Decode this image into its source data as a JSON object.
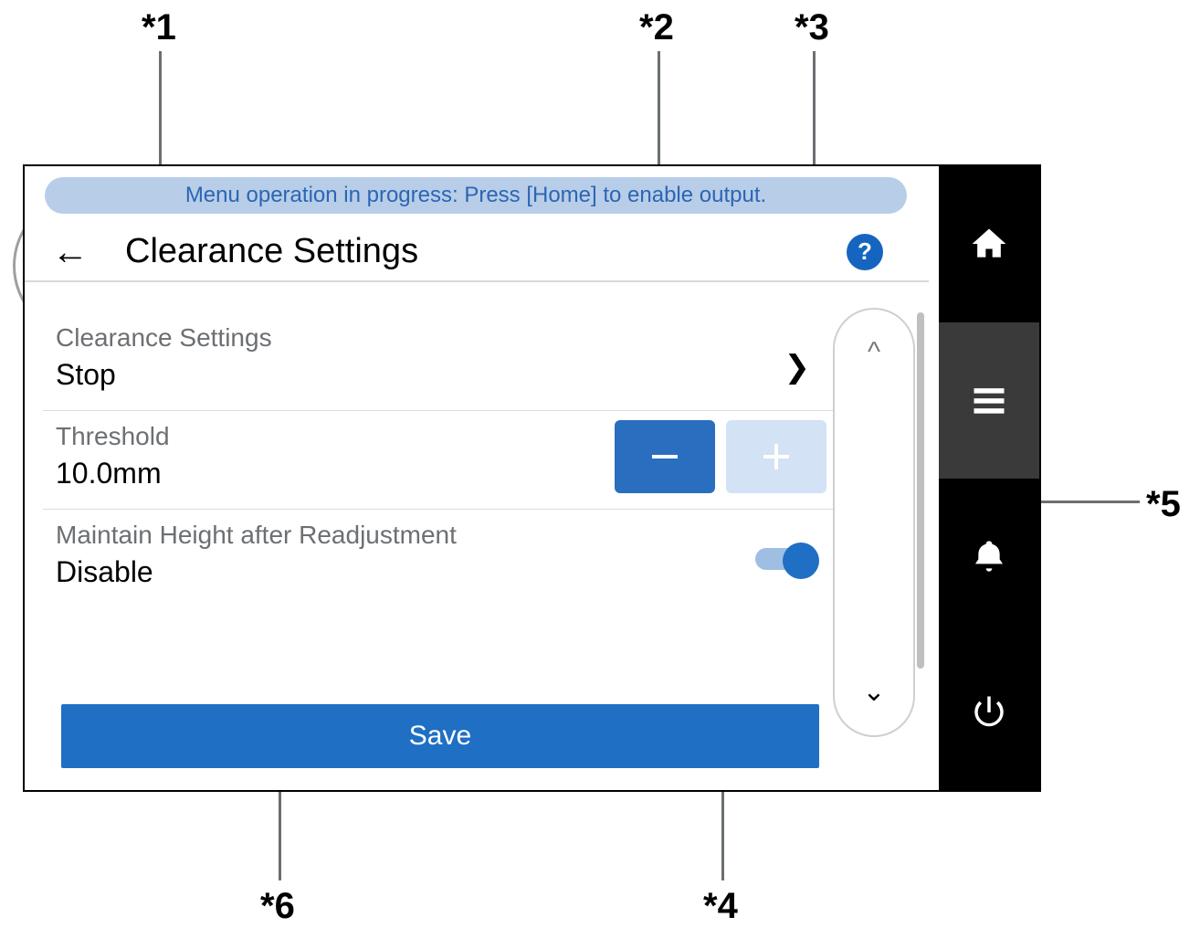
{
  "status_bar": "Menu operation in progress: Press [Home] to enable output.",
  "header": {
    "title": "Clearance Settings"
  },
  "rows": {
    "clearance": {
      "label": "Clearance Settings",
      "value": "Stop"
    },
    "threshold": {
      "label": "Threshold",
      "value": "10.0mm"
    },
    "maintain": {
      "label": "Maintain Height after Readjustment",
      "value": "Disable"
    }
  },
  "save_label": "Save",
  "callouts": {
    "c1": "*1",
    "c2": "*2",
    "c3": "*3",
    "c4": "*4",
    "c5": "*5",
    "c6": "*6"
  }
}
